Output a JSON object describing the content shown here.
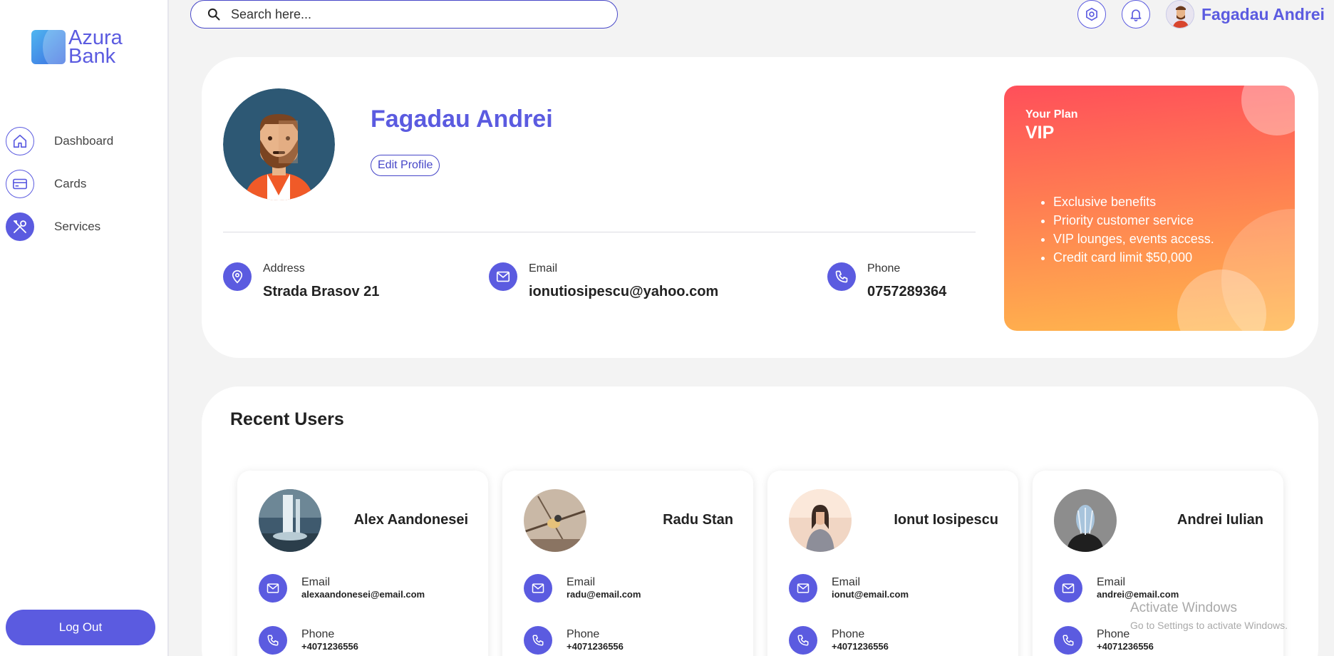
{
  "app": {
    "logo_line1": "Azura",
    "logo_line2": "Bank"
  },
  "sidebar": {
    "items": [
      {
        "label": "Dashboard",
        "icon": "home-icon"
      },
      {
        "label": "Cards",
        "icon": "credit-card-icon"
      },
      {
        "label": "Services",
        "icon": "tools-icon"
      }
    ],
    "logout_label": "Log Out"
  },
  "header": {
    "search_placeholder": "Search here...",
    "user_name": "Fagadau Andrei",
    "settings_icon": "gear-icon",
    "notifications_icon": "bell-icon"
  },
  "profile": {
    "name": "Fagadau Andrei",
    "edit_label": "Edit Profile",
    "address_label": "Address",
    "address_value": "Strada Brasov 21",
    "email_label": "Email",
    "email_value": "ionutiosipescu@yahoo.com",
    "phone_label": "Phone",
    "phone_value": "0757289364"
  },
  "plan": {
    "label": "Your Plan",
    "name": "VIP",
    "benefits": [
      "Exclusive benefits",
      "Priority customer service",
      "VIP lounges, events access.",
      "Credit card limit $50,000"
    ]
  },
  "recent_users": {
    "title": "Recent Users",
    "users": [
      {
        "name": "Alex Aandonesei",
        "email_label": "Email",
        "email": "alexaandonesei@email.com",
        "phone_label": "Phone",
        "phone": "+4071236556"
      },
      {
        "name": "Radu Stan",
        "email_label": "Email",
        "email": "radu@email.com",
        "phone_label": "Phone",
        "phone": "+4071236556"
      },
      {
        "name": "Ionut Iosipescu",
        "email_label": "Email",
        "email": "ionut@email.com",
        "phone_label": "Phone",
        "phone": "+4071236556"
      },
      {
        "name": "Andrei Iulian",
        "email_label": "Email",
        "email": "andrei@email.com",
        "phone_label": "Phone",
        "phone": "+4071236556"
      }
    ]
  },
  "watermark": {
    "line1": "Activate Windows",
    "line2": "Go to Settings to activate Windows."
  },
  "colors": {
    "accent": "#5b5be0",
    "plan_gradient_top": "#ff4f5a",
    "plan_gradient_bottom": "#ffb74d",
    "background": "#f3f3f3"
  }
}
